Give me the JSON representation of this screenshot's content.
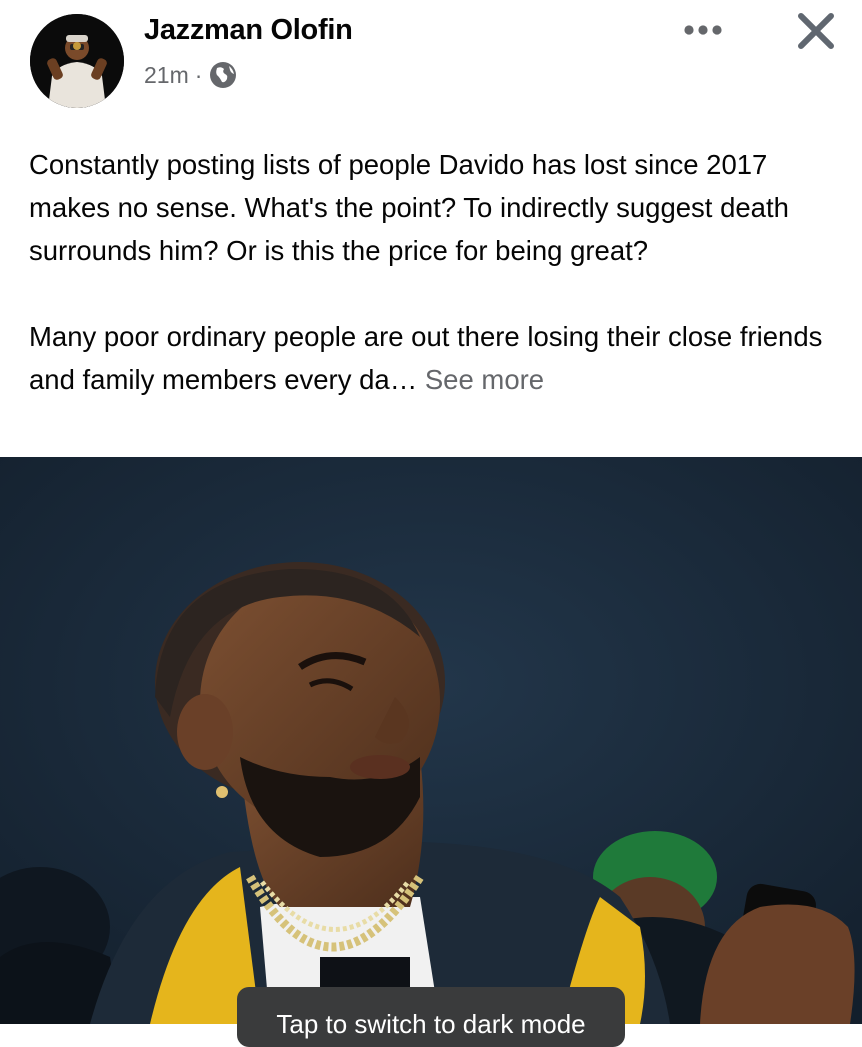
{
  "post": {
    "author": "Jazzman Olofin",
    "time": "21m",
    "separator": "·",
    "privacy_icon": "globe-icon",
    "paragraphs": [
      "Constantly posting lists of people Davido has lost since 2017 makes no sense. What's the point? To indirectly suggest death surrounds him? Or is this the price for being great?",
      "Many poor ordinary people are out there losing  their close friends and family members every da…"
    ],
    "see_more": "See more"
  },
  "header_actions": {
    "more_icon": "more-horizontal-icon",
    "close_icon": "close-icon"
  },
  "toast": {
    "text": "Tap to switch to dark mode"
  },
  "colors": {
    "text": "#050505",
    "secondary_text": "#65676b",
    "photo_background": "#1a2a3b",
    "toast_background": "#3a3b3c"
  }
}
